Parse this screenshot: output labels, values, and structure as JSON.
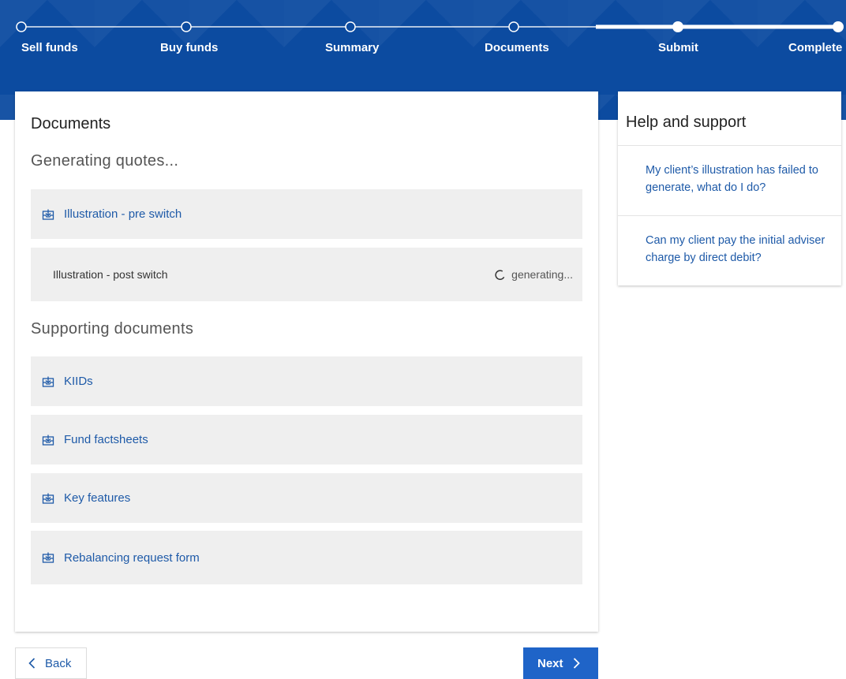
{
  "progress": {
    "steps": [
      {
        "label": "Sell funds",
        "state": "done"
      },
      {
        "label": "Buy funds",
        "state": "done"
      },
      {
        "label": "Summary",
        "state": "done"
      },
      {
        "label": "Documents",
        "state": "current"
      },
      {
        "label": "Submit",
        "state": "upcoming"
      },
      {
        "label": "Complete",
        "state": "upcoming"
      }
    ]
  },
  "main": {
    "title": "Documents",
    "generating_title": "Generating quotes...",
    "quotes": [
      {
        "label": "Illustration - pre switch",
        "icon": "download-icon"
      },
      {
        "label": "Illustration - post switch",
        "status": "generating..."
      }
    ],
    "supporting_title": "Supporting documents",
    "supporting": [
      {
        "label": "KIIDs",
        "icon": "download-icon"
      },
      {
        "label": "Fund factsheets",
        "icon": "download-icon"
      },
      {
        "label": "Key features",
        "icon": "download-icon"
      },
      {
        "label": "Rebalancing request form",
        "icon": "download-icon"
      }
    ]
  },
  "help": {
    "title": "Help and support",
    "links": [
      "My client’s illustration has failed to generate, what do I do?",
      "Can my client pay the initial adviser charge by direct debit?"
    ]
  },
  "nav": {
    "back_label": "Back",
    "next_label": "Next"
  },
  "colors": {
    "header_blue": "#0c4ba0",
    "link_blue": "#1e5aa8",
    "button_blue": "#1f64c8",
    "row_grey": "#efefef"
  }
}
